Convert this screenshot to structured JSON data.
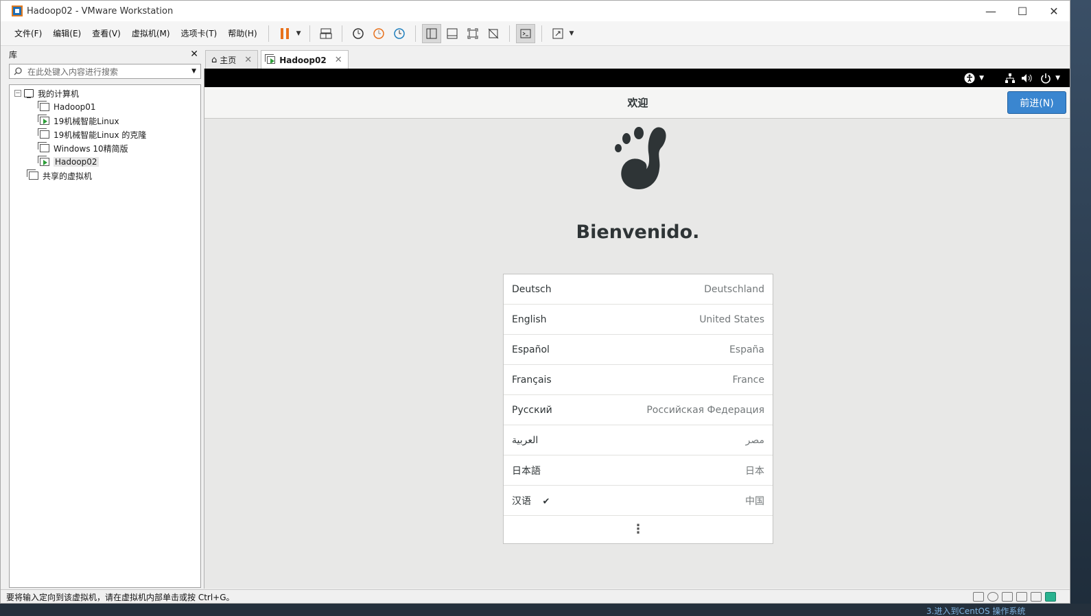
{
  "window": {
    "title": "Hadoop02 - VMware Workstation"
  },
  "menu": [
    "文件(F)",
    "编辑(E)",
    "查看(V)",
    "虚拟机(M)",
    "选项卡(T)",
    "帮助(H)"
  ],
  "library": {
    "title": "库",
    "search_placeholder": "在此处键入内容进行搜索",
    "root": "我的计算机",
    "vms": [
      "Hadoop01",
      "19机械智能Linux",
      "19机械智能Linux 的克隆",
      "Windows 10精简版",
      "Hadoop02"
    ],
    "shared": "共享的虚拟机"
  },
  "tabs": {
    "home": "主页",
    "current": "Hadoop02"
  },
  "guest": {
    "header_title": "欢迎",
    "next_button": "前进(N)",
    "welcome": "Bienvenido.",
    "languages": [
      {
        "name": "Deutsch",
        "country": "Deutschland"
      },
      {
        "name": "English",
        "country": "United States"
      },
      {
        "name": "Español",
        "country": "España"
      },
      {
        "name": "Français",
        "country": "France"
      },
      {
        "name": "Русский",
        "country": "Российская Федерация"
      },
      {
        "name": "العربية",
        "country": "مصر"
      },
      {
        "name": "日本語",
        "country": "日本"
      },
      {
        "name": "汉语",
        "country": "中国",
        "check": "✔"
      }
    ],
    "more": "⋮"
  },
  "statusbar": {
    "text": "要将输入定向到该虚拟机，请在虚拟机内部单击或按 Ctrl+G。"
  },
  "colors": {
    "accent": "#3a86d0",
    "pause": "#e8701a"
  }
}
